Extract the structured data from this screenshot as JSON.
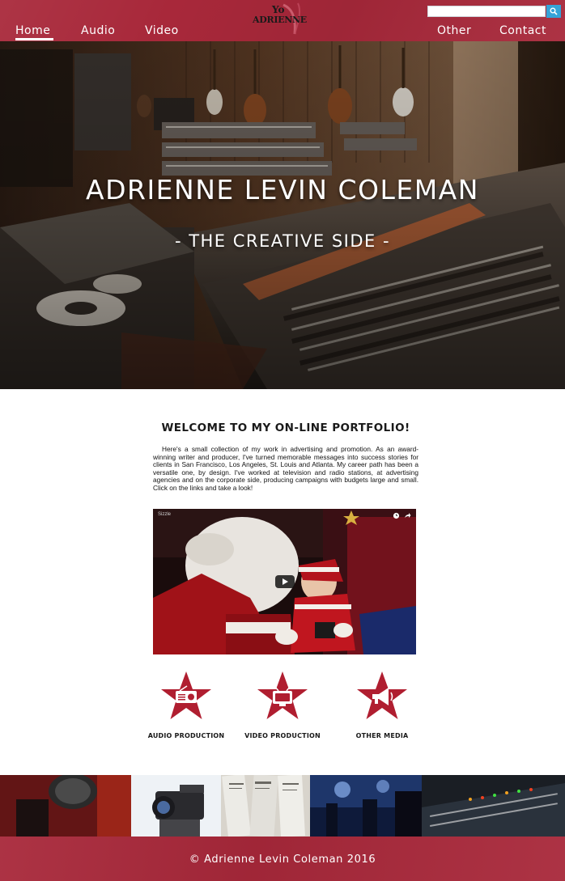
{
  "nav": {
    "home": "Home",
    "audio": "Audio",
    "video": "Video",
    "other": "Other",
    "contact": "Contact"
  },
  "logo": {
    "line1": "Yo",
    "line2": "ADRIENNE"
  },
  "search": {
    "value": "",
    "icon": "search-icon"
  },
  "hero": {
    "title": "ADRIENNE LEVIN COLEMAN",
    "subtitle": "- THE CREATIVE SIDE -"
  },
  "main": {
    "welcome": "WELCOME TO MY ON-LINE PORTFOLIO!",
    "intro": "Here's a small collection of my work in advertising and promotion. As an award-winning writer and producer, I've turned memorable messages into success stories for clients in San Francisco, Los Angeles, St. Louis and Atlanta. My career path has been a versatile one, by design. I've worked at television and radio stations, at advertising agencies and on the corporate side, producing campaigns with budgets large and small. Click on the links and take a look!",
    "video": {
      "label": "Sizzle"
    }
  },
  "categories": [
    {
      "label": "AUDIO PRODUCTION",
      "icon": "radio-icon"
    },
    {
      "label": "VIDEO PRODUCTION",
      "icon": "tv-icon"
    },
    {
      "label": "OTHER MEDIA",
      "icon": "megaphone-icon"
    }
  ],
  "footer": {
    "copyright": "© Adrienne Levin Coleman 2016"
  },
  "colors": {
    "brand_red": "#a8283a",
    "search_button": "#35a3d8",
    "star_red": "#b01e30"
  }
}
